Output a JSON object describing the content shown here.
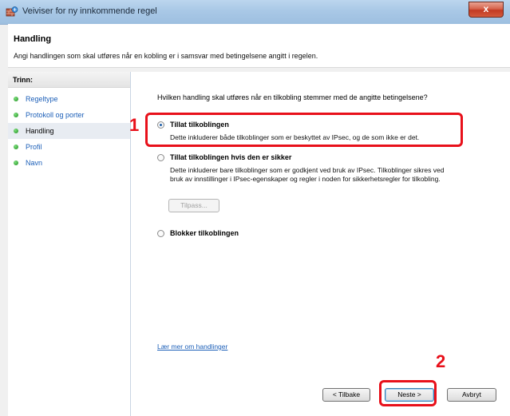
{
  "window": {
    "title": "Veiviser for ny innkommende regel",
    "close_label": "x"
  },
  "header": {
    "title": "Handling",
    "subtitle": "Angi handlingen som skal utføres når en kobling er i samsvar med betingelsene angitt i regelen."
  },
  "steps": {
    "title": "Trinn:",
    "items": [
      {
        "label": "Regeltype",
        "state": "link"
      },
      {
        "label": "Protokoll og porter",
        "state": "link"
      },
      {
        "label": "Handling",
        "state": "current"
      },
      {
        "label": "Profil",
        "state": "link"
      },
      {
        "label": "Navn",
        "state": "link"
      }
    ]
  },
  "main": {
    "question": "Hvilken handling skal utføres når en tilkobling stemmer med de angitte betingelsene?",
    "options": [
      {
        "title": "Tillat tilkoblingen",
        "description": "Dette inkluderer både tilkoblinger som er beskyttet av IPsec, og de som ikke er det.",
        "selected": true
      },
      {
        "title": "Tillat tilkoblingen hvis den er sikker",
        "description_line1": "Dette inkluderer bare tilkoblinger som er godkjent ved bruk av IPsec. Tilkoblinger sikres ved",
        "description_line2": "bruk av innstillinger i IPsec-egenskaper og regler i noden for sikkerhetsregler for tilkobling.",
        "selected": false,
        "customize_label": "Tilpass..."
      },
      {
        "title": "Blokker tilkoblingen",
        "selected": false
      }
    ],
    "learn_more": "Lær mer om handlinger"
  },
  "footer": {
    "back_label": "< Tilbake",
    "next_label": "Neste >",
    "cancel_label": "Avbryt"
  },
  "annotations": {
    "callout1": "1",
    "callout2": "2",
    "color": "#e8101a"
  },
  "colors": {
    "link": "#1c5fb8",
    "title_bar": "#a9c8e6",
    "close_button": "#c23a22",
    "step_bullet": "#1f8f1f"
  }
}
